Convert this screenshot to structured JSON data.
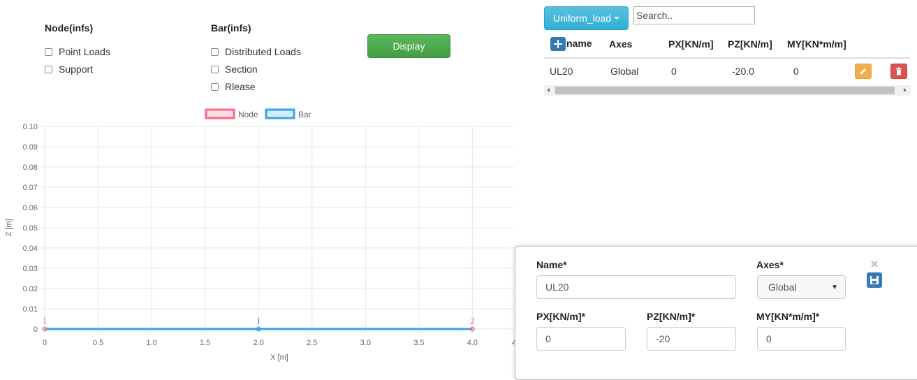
{
  "node_section": {
    "header": "Node(infs)",
    "options": [
      "Point Loads",
      "Support"
    ]
  },
  "bar_section": {
    "header": "Bar(infs)",
    "options": [
      "Distributed Loads",
      "Section",
      "Rlease"
    ]
  },
  "display_button": "Display",
  "load_dropdown": "Uniform_load",
  "search": {
    "placeholder": "Search..",
    "value": ""
  },
  "table": {
    "columns": [
      "name",
      "Axes",
      "PX[KN/m]",
      "PZ[KN/m]",
      "MY[KN*m/m]"
    ],
    "rows": [
      {
        "name": "UL20",
        "axes": "Global",
        "px": "0",
        "pz": "-20.0",
        "my": "0"
      }
    ]
  },
  "icons": {
    "add": "plus-icon",
    "edit": "pencil-icon",
    "delete": "trash-icon",
    "close": "close-icon",
    "save": "floppy-disk-icon"
  },
  "colors": {
    "node": "#ff6384",
    "bar": "#36a2eb",
    "display_green": "#5cb85c",
    "dropdown_blue": "#5bc0de",
    "edit_orange": "#f0ad4e",
    "delete_red": "#d9534f",
    "primary_blue": "#337ab7"
  },
  "chart_data": {
    "type": "line",
    "legend": [
      "Node",
      "Bar"
    ],
    "xlabel": "X [m]",
    "ylabel": "Z [m]",
    "xlim": [
      0,
      4.0
    ],
    "ylim": [
      0,
      0.1
    ],
    "x_ticks": [
      "0",
      "0.5",
      "1.0",
      "1.5",
      "2.0",
      "2.5",
      "3.0",
      "3.5",
      "4.0",
      "4"
    ],
    "y_ticks": [
      "0",
      "0.01",
      "0.02",
      "0.03",
      "0.04",
      "0.05",
      "0.06",
      "0.07",
      "0.08",
      "0.09",
      "0.10"
    ],
    "grid": true,
    "series": [
      {
        "name": "Node",
        "points": [
          {
            "x": 0,
            "z": 0,
            "label": "1"
          },
          {
            "x": 4.0,
            "z": 0,
            "label": "2"
          }
        ]
      },
      {
        "name": "Bar",
        "points": [
          {
            "x": 0,
            "z": 0
          },
          {
            "x": 4.0,
            "z": 0
          }
        ],
        "mid_label": {
          "x": 2.0,
          "z": 0,
          "label": "1"
        }
      }
    ]
  },
  "form": {
    "name_label": "Name*",
    "name_value": "UL20",
    "axes_label": "Axes*",
    "axes_value": "Global",
    "px_label": "PX[KN/m]*",
    "px_value": "0",
    "pz_label": "PZ[KN/m]*",
    "pz_value": "-20",
    "my_label": "MY[KN*m/m]*",
    "my_value": "0"
  }
}
